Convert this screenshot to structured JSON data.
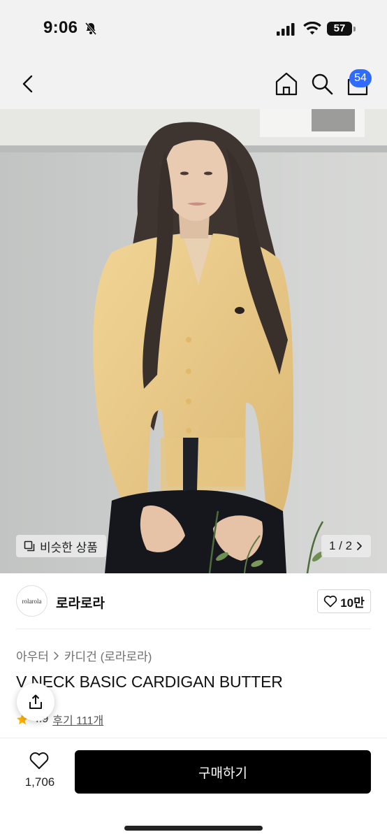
{
  "status_bar": {
    "time": "9:06",
    "battery": "57"
  },
  "nav": {
    "cart_count": "54"
  },
  "hero": {
    "similar_label": "비슷한 상품",
    "pager": "1 / 2"
  },
  "brand": {
    "logo_text": "rolarola",
    "name": "로라로라",
    "likes": "10만"
  },
  "breadcrumb": {
    "category": "아우터",
    "subcategory": "카디건 (로라로라)"
  },
  "product": {
    "title": "V NECK BASIC CARDIGAN BUTTER",
    "rating": "4.9",
    "reviews": "후기 111개"
  },
  "bottom": {
    "wish_count": "1,706",
    "buy_label": "구매하기"
  },
  "colors": {
    "accent": "#2f6bff",
    "star": "#ffb400",
    "buy_bg": "#000000"
  }
}
